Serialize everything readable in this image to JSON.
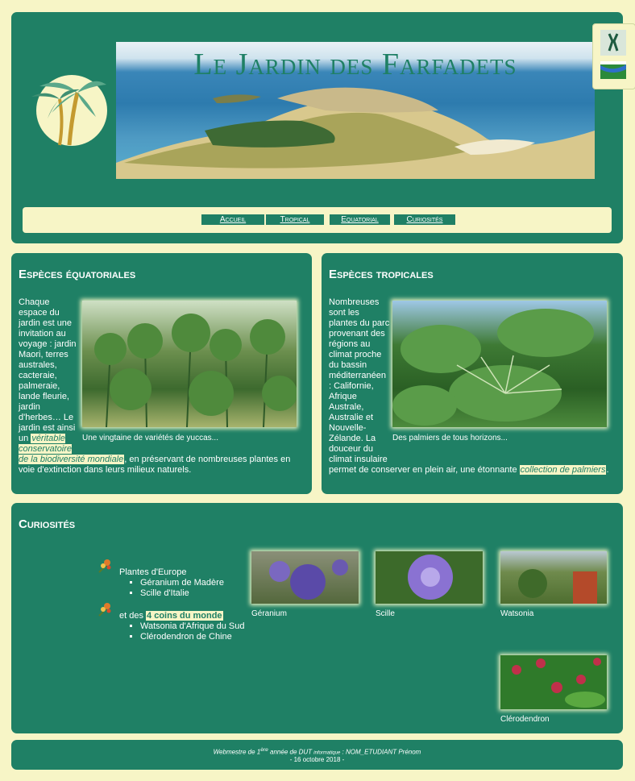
{
  "header": {
    "title": "Le Jardin des Farfadets",
    "nav": [
      {
        "label": "Accueil"
      },
      {
        "label": "Tropical"
      },
      {
        "label": "Equatorial"
      },
      {
        "label": "Curiosités"
      }
    ]
  },
  "equatorial": {
    "title": "Espèces équatoriales",
    "text_before": "Chaque espace du jardin est une invitation au voyage : jardin Maori, terres australes, cacteraie, palmeraie, lande fleurie, jardin d'herbes… Le jardin est ainsi un",
    "highlight": "véritable conservatoire de la biodiversité mondiale",
    "text_after": ", en préservant de nombreuses plantes en voie d'extinction dans leurs milieux naturels.",
    "caption": "Une vingtaine de variétés de yuccas..."
  },
  "tropical": {
    "title": "Espèces tropicales",
    "text_before": "Nombreuses sont les plantes du parc provenant des régions au climat proche du bassin méditerranéen : Californie, Afrique Australe, Australie et Nouvelle-Zélande. La douceur du climat insulaire permet de conserver en plein air, une étonnante",
    "highlight": "collection de palmiers",
    "text_after": ".",
    "caption": "Des palmiers de tous horizons..."
  },
  "curiosities": {
    "title": "Curiosités",
    "group1_label": "Plantes d'Europe",
    "group1_items": [
      "Géranium de Madère",
      "Scille d'Italie"
    ],
    "group2_prefix": "et des ",
    "group2_highlight": "4 coins du monde",
    "group2_items": [
      "Watsonia d'Afrique du Sud",
      "Clérodendron de Chine"
    ],
    "captions": [
      "Géranium",
      "Scille",
      "Watsonia",
      "Clérodendron"
    ]
  },
  "footer": {
    "line1_a": "Webmestre de 1",
    "line1_sup": "ère",
    "line1_b": " année de DUT ",
    "line1_small": "informatique",
    "line1_c": " : NOM_ETUDIANT Prénom",
    "line2": "- 16 octobre 2018 -"
  },
  "colors": {
    "panel": "#1f8065",
    "background": "#f7f5c6"
  }
}
